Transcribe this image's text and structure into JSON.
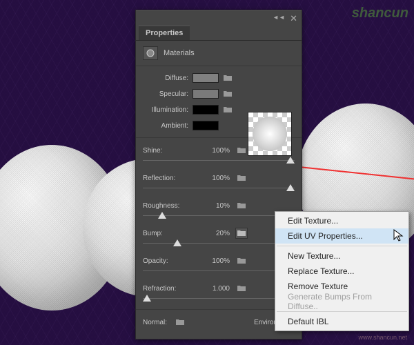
{
  "watermark": "shancun",
  "watermark2": "www.shancun.net",
  "panel": {
    "title": "Properties",
    "section": "Materials",
    "colorProps": {
      "diffuse": {
        "label": "Diffuse:",
        "color": "#808080"
      },
      "specular": {
        "label": "Specular:",
        "color": "#7a7a7a"
      },
      "illumination": {
        "label": "Illumination:",
        "color": "#000000"
      },
      "ambient": {
        "label": "Ambient:",
        "color": "#000000"
      }
    },
    "sliders": {
      "shine": {
        "label": "Shine:",
        "value": "100%",
        "pos": 100
      },
      "reflection": {
        "label": "Reflection:",
        "value": "100%",
        "pos": 100
      },
      "roughness": {
        "label": "Roughness:",
        "value": "10%",
        "pos": 10
      },
      "bump": {
        "label": "Bump:",
        "value": "20%",
        "pos": 20
      },
      "opacity": {
        "label": "Opacity:",
        "value": "100%",
        "pos": 100
      },
      "refraction": {
        "label": "Refraction:",
        "value": "1.000",
        "pos": 0
      }
    },
    "bottom": {
      "normal": "Normal:",
      "environment": "Environment:"
    }
  },
  "contextMenu": {
    "editTexture": "Edit Texture...",
    "editUV": "Edit UV Properties...",
    "newTexture": "New Texture...",
    "replaceTexture": "Replace Texture...",
    "removeTexture": "Remove Texture",
    "genBumps": "Generate Bumps From Diffuse..",
    "defaultIBL": "Default IBL"
  }
}
